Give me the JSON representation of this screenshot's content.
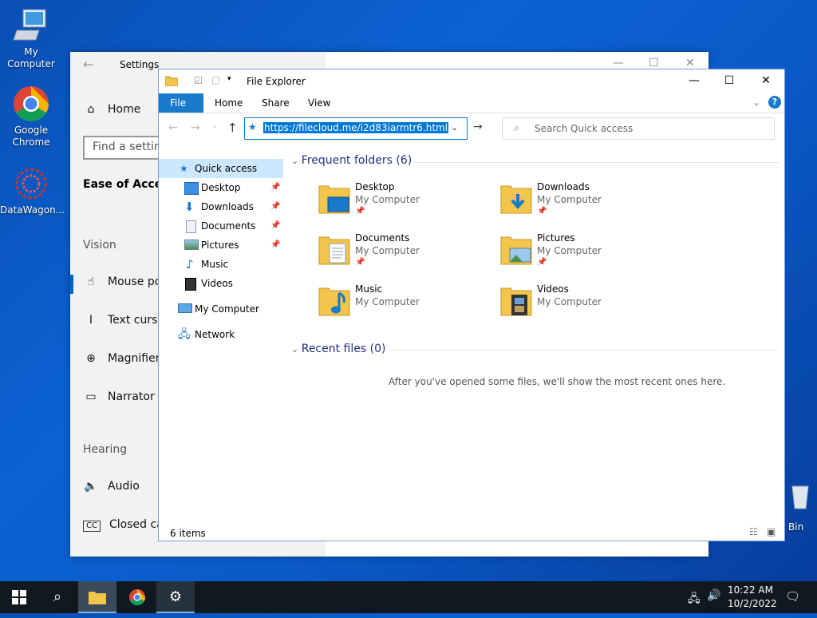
{
  "desktop": {
    "icons": [
      {
        "label": "My Computer"
      },
      {
        "label": "Google Chrome"
      },
      {
        "label": "DataWagon..."
      }
    ],
    "recycle_label": "Bin"
  },
  "settings": {
    "title": "Settings",
    "home": "Home",
    "search_placeholder": "Find a setting",
    "category": "Ease of Access",
    "vision_head": "Vision",
    "items": [
      {
        "label": "Mouse po",
        "icon": "mouse-pointer-icon"
      },
      {
        "label": "Text curso",
        "icon": "text-cursor-icon"
      },
      {
        "label": "Magnifier",
        "icon": "magnifier-icon"
      },
      {
        "label": "Narrator",
        "icon": "narrator-icon"
      }
    ],
    "hearing_head": "Hearing",
    "hearing_items": [
      {
        "label": "Audio",
        "icon": "speaker-icon"
      },
      {
        "label": "Closed cap",
        "icon": "cc-icon"
      }
    ]
  },
  "explorer": {
    "title": "File Explorer",
    "tabs": [
      "File",
      "Home",
      "Share",
      "View"
    ],
    "address": "https://filecloud.me/i2d83iarmtr6.html",
    "search_placeholder": "Search Quick access",
    "nav": [
      {
        "label": "Quick access",
        "icon": "star-icon"
      },
      {
        "label": "Desktop",
        "icon": "desktop-icon",
        "pinned": true
      },
      {
        "label": "Downloads",
        "icon": "download-icon",
        "pinned": true
      },
      {
        "label": "Documents",
        "icon": "documents-icon",
        "pinned": true
      },
      {
        "label": "Pictures",
        "icon": "pictures-icon",
        "pinned": true
      },
      {
        "label": "Music",
        "icon": "music-icon"
      },
      {
        "label": "Videos",
        "icon": "videos-icon"
      },
      {
        "label": "My Computer",
        "icon": "computer-icon"
      },
      {
        "label": "Network",
        "icon": "network-icon"
      }
    ],
    "frequent_header": "Frequent folders (6)",
    "folders": [
      {
        "name": "Desktop",
        "location": "My Computer",
        "pinned": true
      },
      {
        "name": "Downloads",
        "location": "My Computer",
        "pinned": true
      },
      {
        "name": "Documents",
        "location": "My Computer",
        "pinned": true
      },
      {
        "name": "Pictures",
        "location": "My Computer",
        "pinned": true
      },
      {
        "name": "Music",
        "location": "My Computer",
        "pinned": false
      },
      {
        "name": "Videos",
        "location": "My Computer",
        "pinned": false
      }
    ],
    "recent_header": "Recent files (0)",
    "recent_empty": "After you've opened some files, we'll show the most recent ones here.",
    "status": "6 items"
  },
  "taskbar": {
    "time": "10:22 AM",
    "date": "10/2/2022"
  },
  "colors": {
    "accent": "#0078d7",
    "folder": "#f3c54a",
    "taskbar": "#101820"
  }
}
